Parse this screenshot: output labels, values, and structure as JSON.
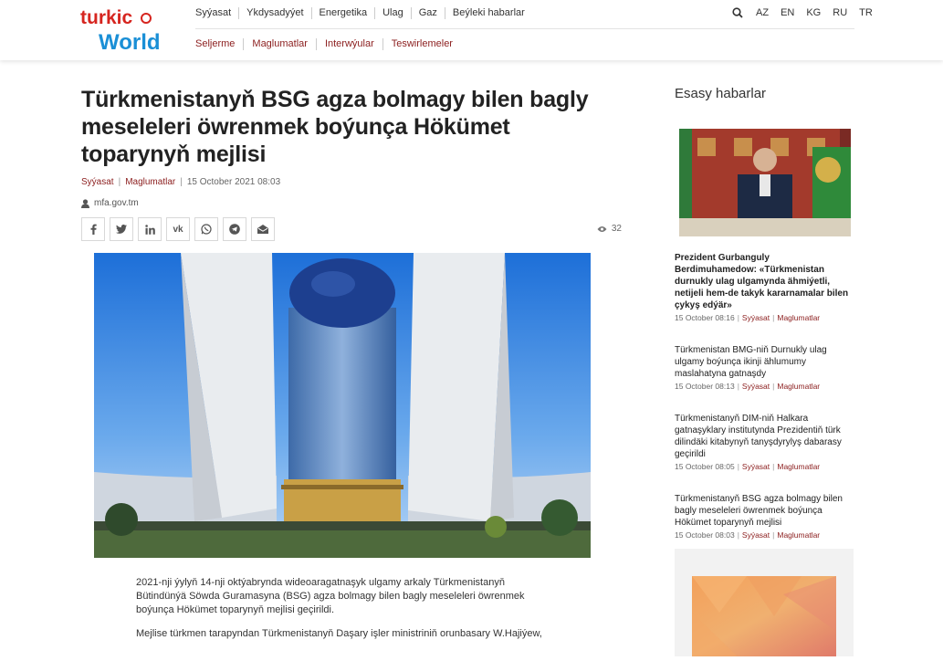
{
  "logo": {
    "line1": "turkic",
    "line2": "World"
  },
  "nav_primary": [
    "Syýasat",
    "Ykdysadyýet",
    "Energetika",
    "Ulag",
    "Gaz",
    "Beýleki habarlar"
  ],
  "nav_secondary": [
    "Seljerme",
    "Maglumatlar",
    "Interwýular",
    "Teswirlemeler"
  ],
  "languages": [
    "AZ",
    "EN",
    "KG",
    "RU",
    "TR"
  ],
  "article": {
    "title": "Türkmenistanyň BSG agza bolmagy bilen bagly meseleleri öwrenmek boýunça Hökümet toparynyň mejlisi",
    "category1": "Syýasat",
    "category2": "Maglumatlar",
    "date": "15 October 2021 08:03",
    "author": "mfa.gov.tm",
    "views": "32",
    "paragraphs": [
      "2021-nji ýylyň 14-nji oktýabrynda wideoaragatnaşyk ulgamy arkaly Türkmenistanyň Bütindünýä Söwda Guramasyna (BSG) agza bolmagy bilen bagly meseleleri öwrenmek boýunça Hökümet toparynyň mejlisi geçirildi.",
      "Mejlise türkmen tarapyndan Türkmenistanyň Daşary işler ministriniň orunbasary W.Hajiýew,"
    ]
  },
  "share_icons": [
    "facebook-icon",
    "twitter-icon",
    "linkedin-icon",
    "vk-icon",
    "whatsapp-icon",
    "telegram-icon",
    "email-icon"
  ],
  "sidebar": {
    "title": "Esasy habarlar",
    "news": [
      {
        "title": "Prezident Gurbanguly Berdimuhamedow: «Türkmenistan durnukly ulag ulgamynda ähmiýetli, netijeli hem-de takyk kararnamalar bilen çykyş edýär»",
        "date": "15 October 08:16",
        "c1": "Syýasat",
        "c2": "Maglumatlar",
        "bold": true
      },
      {
        "title": "Türkmenistan BMG-niň Durnukly ulag ulgamy boýunça ikinji ählumumy maslahatyna gatnaşdy",
        "date": "15 October 08:13",
        "c1": "Syýasat",
        "c2": "Maglumatlar",
        "bold": false
      },
      {
        "title": "Türkmenistanyň DIM-niň Halkara gatnaşyklary institutynda Prezidentiň türk dilindäki kitabynyň tanyşdyrylyş dabarasy geçirildi",
        "date": "15 October 08:05",
        "c1": "Syýasat",
        "c2": "Maglumatlar",
        "bold": false
      },
      {
        "title": "Türkmenistanyň BSG agza bolmagy bilen bagly meseleleri öwrenmek boýunça Hökümet toparynyň mejlisi",
        "date": "15 October 08:03",
        "c1": "Syýasat",
        "c2": "Maglumatlar",
        "bold": false
      }
    ]
  },
  "colors": {
    "accent": "#8b1d1d",
    "logo_red": "#d6251f",
    "logo_blue": "#1a8fd6"
  }
}
